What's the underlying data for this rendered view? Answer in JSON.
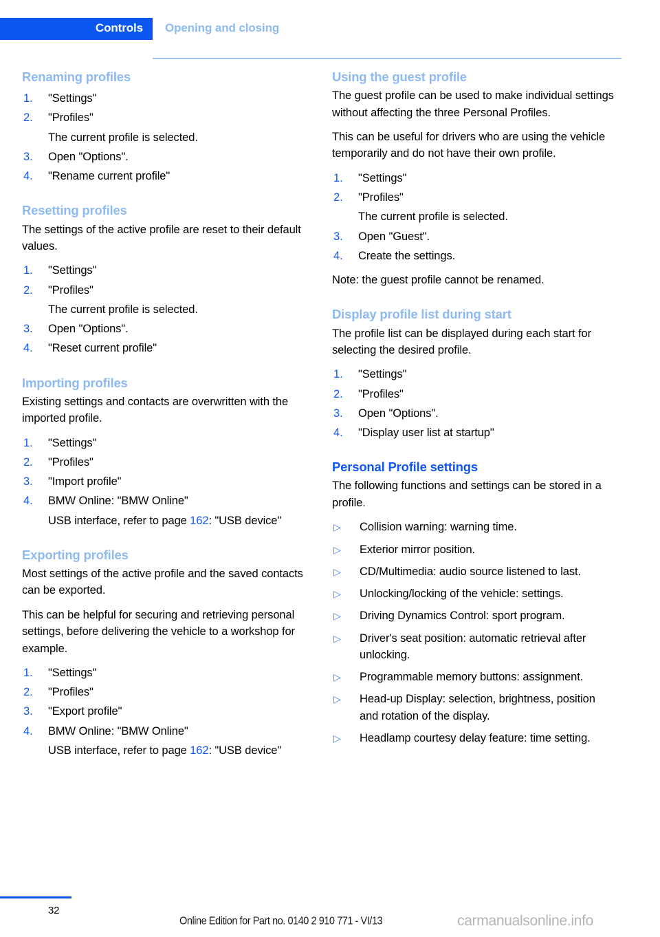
{
  "header": {
    "chapter_tab": "Controls",
    "section_tab": "Opening and closing"
  },
  "footer": {
    "page_number": "32",
    "edition_line": "Online Edition for Part no. 0140 2 910 771 - VI/13",
    "watermark": "carmanualsonline.info"
  },
  "colors": {
    "accent_strong": "#1356ea",
    "accent_light": "#8fbaf0",
    "tab_background": "#0a56f0",
    "text": "#000000"
  },
  "left_column": {
    "blocks": [
      {
        "title": "Renaming profiles",
        "level": "minor",
        "paragraphs": [],
        "steps": [
          {
            "marker": "1.",
            "text": "\"Settings\""
          },
          {
            "marker": "2.",
            "text": "\"Profiles\""
          },
          {
            "marker": "",
            "text": "The current profile is selected."
          },
          {
            "marker": "3.",
            "text": "Open \"Options\"."
          },
          {
            "marker": "4.",
            "text": "\"Rename current profile\""
          }
        ]
      },
      {
        "title": "Resetting profiles",
        "level": "minor",
        "paragraphs": [
          "The settings of the active profile are reset to their default values."
        ],
        "steps": [
          {
            "marker": "1.",
            "text": "\"Settings\""
          },
          {
            "marker": "2.",
            "text": "\"Profiles\""
          },
          {
            "marker": "",
            "text": "The current profile is selected."
          },
          {
            "marker": "3.",
            "text": "Open \"Options\"."
          },
          {
            "marker": "4.",
            "text": "\"Reset current profile\""
          }
        ]
      },
      {
        "title": "Importing profiles",
        "level": "minor",
        "paragraphs": [
          "Existing settings and contacts are overwritten with the imported profile."
        ],
        "steps": [
          {
            "marker": "1.",
            "text": "\"Settings\""
          },
          {
            "marker": "2.",
            "text": "\"Profiles\""
          },
          {
            "marker": "3.",
            "text": "\"Import profile\""
          },
          {
            "marker": "4.",
            "text": "BMW Online: \"BMW Online\""
          },
          {
            "marker": "",
            "text_before": "USB interface, refer to page ",
            "page_ref": "162",
            "text_after": ": \"USB device\""
          }
        ]
      },
      {
        "title": "Exporting profiles",
        "level": "minor",
        "paragraphs": [
          "Most settings of the active profile and the saved contacts can be exported.",
          "This can be helpful for securing and retrieving personal settings, before delivering the vehicle to a workshop for example."
        ],
        "steps": [
          {
            "marker": "1.",
            "text": "\"Settings\""
          },
          {
            "marker": "2.",
            "text": "\"Profiles\""
          },
          {
            "marker": "3.",
            "text": "\"Export profile\""
          },
          {
            "marker": "4.",
            "text": "BMW Online: \"BMW Online\""
          },
          {
            "marker": "",
            "text_before": "USB interface, refer to page ",
            "page_ref": "162",
            "text_after": ": \"USB device\""
          }
        ]
      }
    ]
  },
  "right_column": {
    "blocks": [
      {
        "title": "Using the guest profile",
        "level": "minor",
        "paragraphs": [
          "The guest profile can be used to make individual settings without affecting the three Personal Profiles.",
          "This can be useful for drivers who are using the vehicle temporarily and do not have their own profile."
        ],
        "steps": [
          {
            "marker": "1.",
            "text": "\"Settings\""
          },
          {
            "marker": "2.",
            "text": "\"Profiles\""
          },
          {
            "marker": "",
            "text": "The current profile is selected."
          },
          {
            "marker": "3.",
            "text": "Open \"Guest\"."
          },
          {
            "marker": "4.",
            "text": "Create the settings."
          }
        ],
        "trailing_paragraphs": [
          "Note: the guest profile cannot be renamed."
        ]
      },
      {
        "title": "Display profile list during start",
        "level": "minor",
        "paragraphs": [
          "The profile list can be displayed during each start for selecting the desired profile."
        ],
        "steps": [
          {
            "marker": "1.",
            "text": "\"Settings\""
          },
          {
            "marker": "2.",
            "text": "\"Profiles\""
          },
          {
            "marker": "3.",
            "text": "Open \"Options\"."
          },
          {
            "marker": "4.",
            "text": "\"Display user list at startup\""
          }
        ]
      },
      {
        "title": "Personal Profile settings",
        "level": "major",
        "paragraphs": [
          "The following functions and settings can be stored in a profile."
        ],
        "bullet_marker": "▷",
        "bullets": [
          "Collision warning: warning time.",
          "Exterior mirror position.",
          "CD/Multimedia: audio source listened to last.",
          "Unlocking/locking of the vehicle: settings.",
          "Driving Dynamics Control: sport program.",
          "Driver's seat position: automatic retrieval after unlocking.",
          "Programmable memory buttons: assignment.",
          "Head-up Display: selection, brightness, position and rotation of the display.",
          "Headlamp courtesy delay feature: time setting."
        ]
      }
    ]
  }
}
